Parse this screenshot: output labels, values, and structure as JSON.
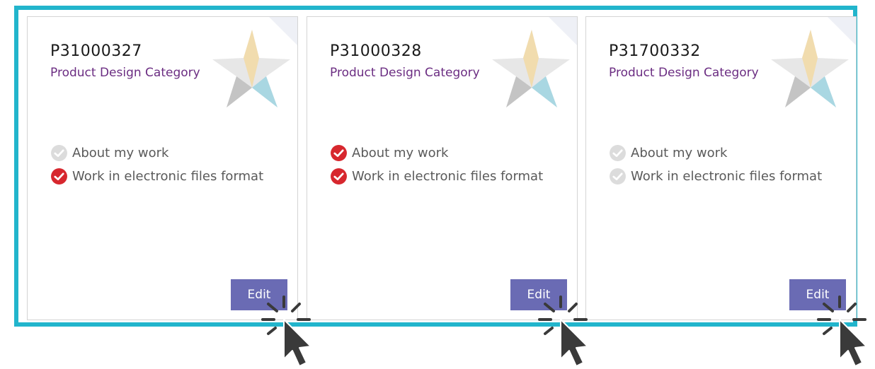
{
  "colors": {
    "frame_border": "#22b5cc",
    "category_text": "#6b2d82",
    "edit_button": "#6a6bb4",
    "check_done": "#d7272e",
    "check_pending": "#dcdcdc"
  },
  "cards": [
    {
      "code": "P31000327",
      "category": "Product Design Category",
      "items": [
        {
          "label": "About my work",
          "done": false
        },
        {
          "label": "Work in electronic files format",
          "done": true
        }
      ],
      "edit_label": "Edit"
    },
    {
      "code": "P31000328",
      "category": "Product Design Category",
      "items": [
        {
          "label": "About my work",
          "done": true
        },
        {
          "label": "Work in electronic files format",
          "done": true
        }
      ],
      "edit_label": "Edit"
    },
    {
      "code": "P31700332",
      "category": "Product Design Category",
      "items": [
        {
          "label": "About my work",
          "done": false
        },
        {
          "label": "Work in electronic files format",
          "done": false
        }
      ],
      "edit_label": "Edit"
    }
  ],
  "icons": {
    "star": "star-logo-icon",
    "check": "check-circle-icon",
    "cursor": "click-cursor-icon"
  }
}
